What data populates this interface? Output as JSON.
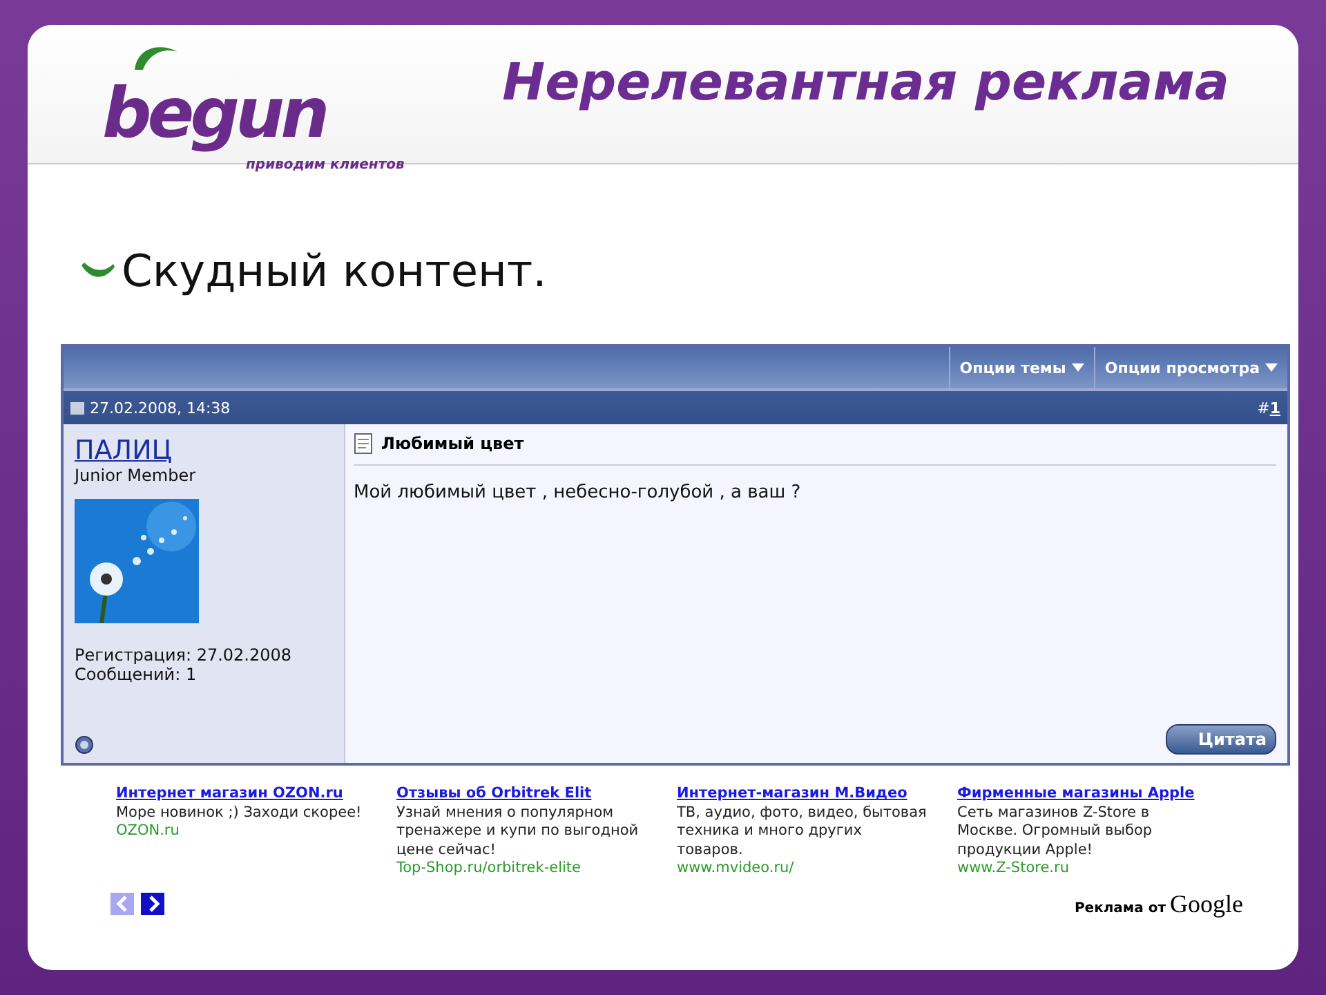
{
  "logo": {
    "name": "begun",
    "tagline": "приводим клиентов"
  },
  "slide_title": "Нерелевантная реклама",
  "bullets": [
    "Скудный контент."
  ],
  "forum": {
    "menus": [
      "Опции темы",
      "Опции просмотра"
    ],
    "post": {
      "date": "27.02.2008, 14:38",
      "number_prefix": "#",
      "number": "1",
      "user": "ПАЛИЦ",
      "rank": "Junior Member",
      "registration": "Регистрация: 27.02.2008",
      "posts": "Сообщений: 1",
      "title": "Любимый цвет",
      "message": "Мой любимый цвет , небесно-голубой , а ваш ?",
      "quote_button": "Цитата"
    }
  },
  "ads": [
    {
      "title": "Интернет магазин OZON.ru",
      "text": "Море новинок ;) Заходи скорее!",
      "url": "OZON.ru"
    },
    {
      "title": "Отзывы об Orbitrek Elit",
      "text": "Узнай мнения о популярном тренажере и купи по выгодной цене сейчас!",
      "url": "Top-Shop.ru/orbitrek-elite"
    },
    {
      "title": "Интернет-магазин М.Видео",
      "text": "ТВ, аудио, фото, видео, бытовая техника и много других товаров.",
      "url": "www.mvideo.ru/"
    },
    {
      "title": "Фирменные магазины Apple",
      "text": "Сеть магазинов Z-Store в Москве. Огромный выбор продукции Apple!",
      "url": "www.Z-Store.ru"
    }
  ],
  "ad_nav": [
    {
      "kind": "prev",
      "disabled": true
    },
    {
      "kind": "next",
      "disabled": false
    }
  ],
  "ads_footer": {
    "label": "Реклама от",
    "brand": "Google"
  }
}
